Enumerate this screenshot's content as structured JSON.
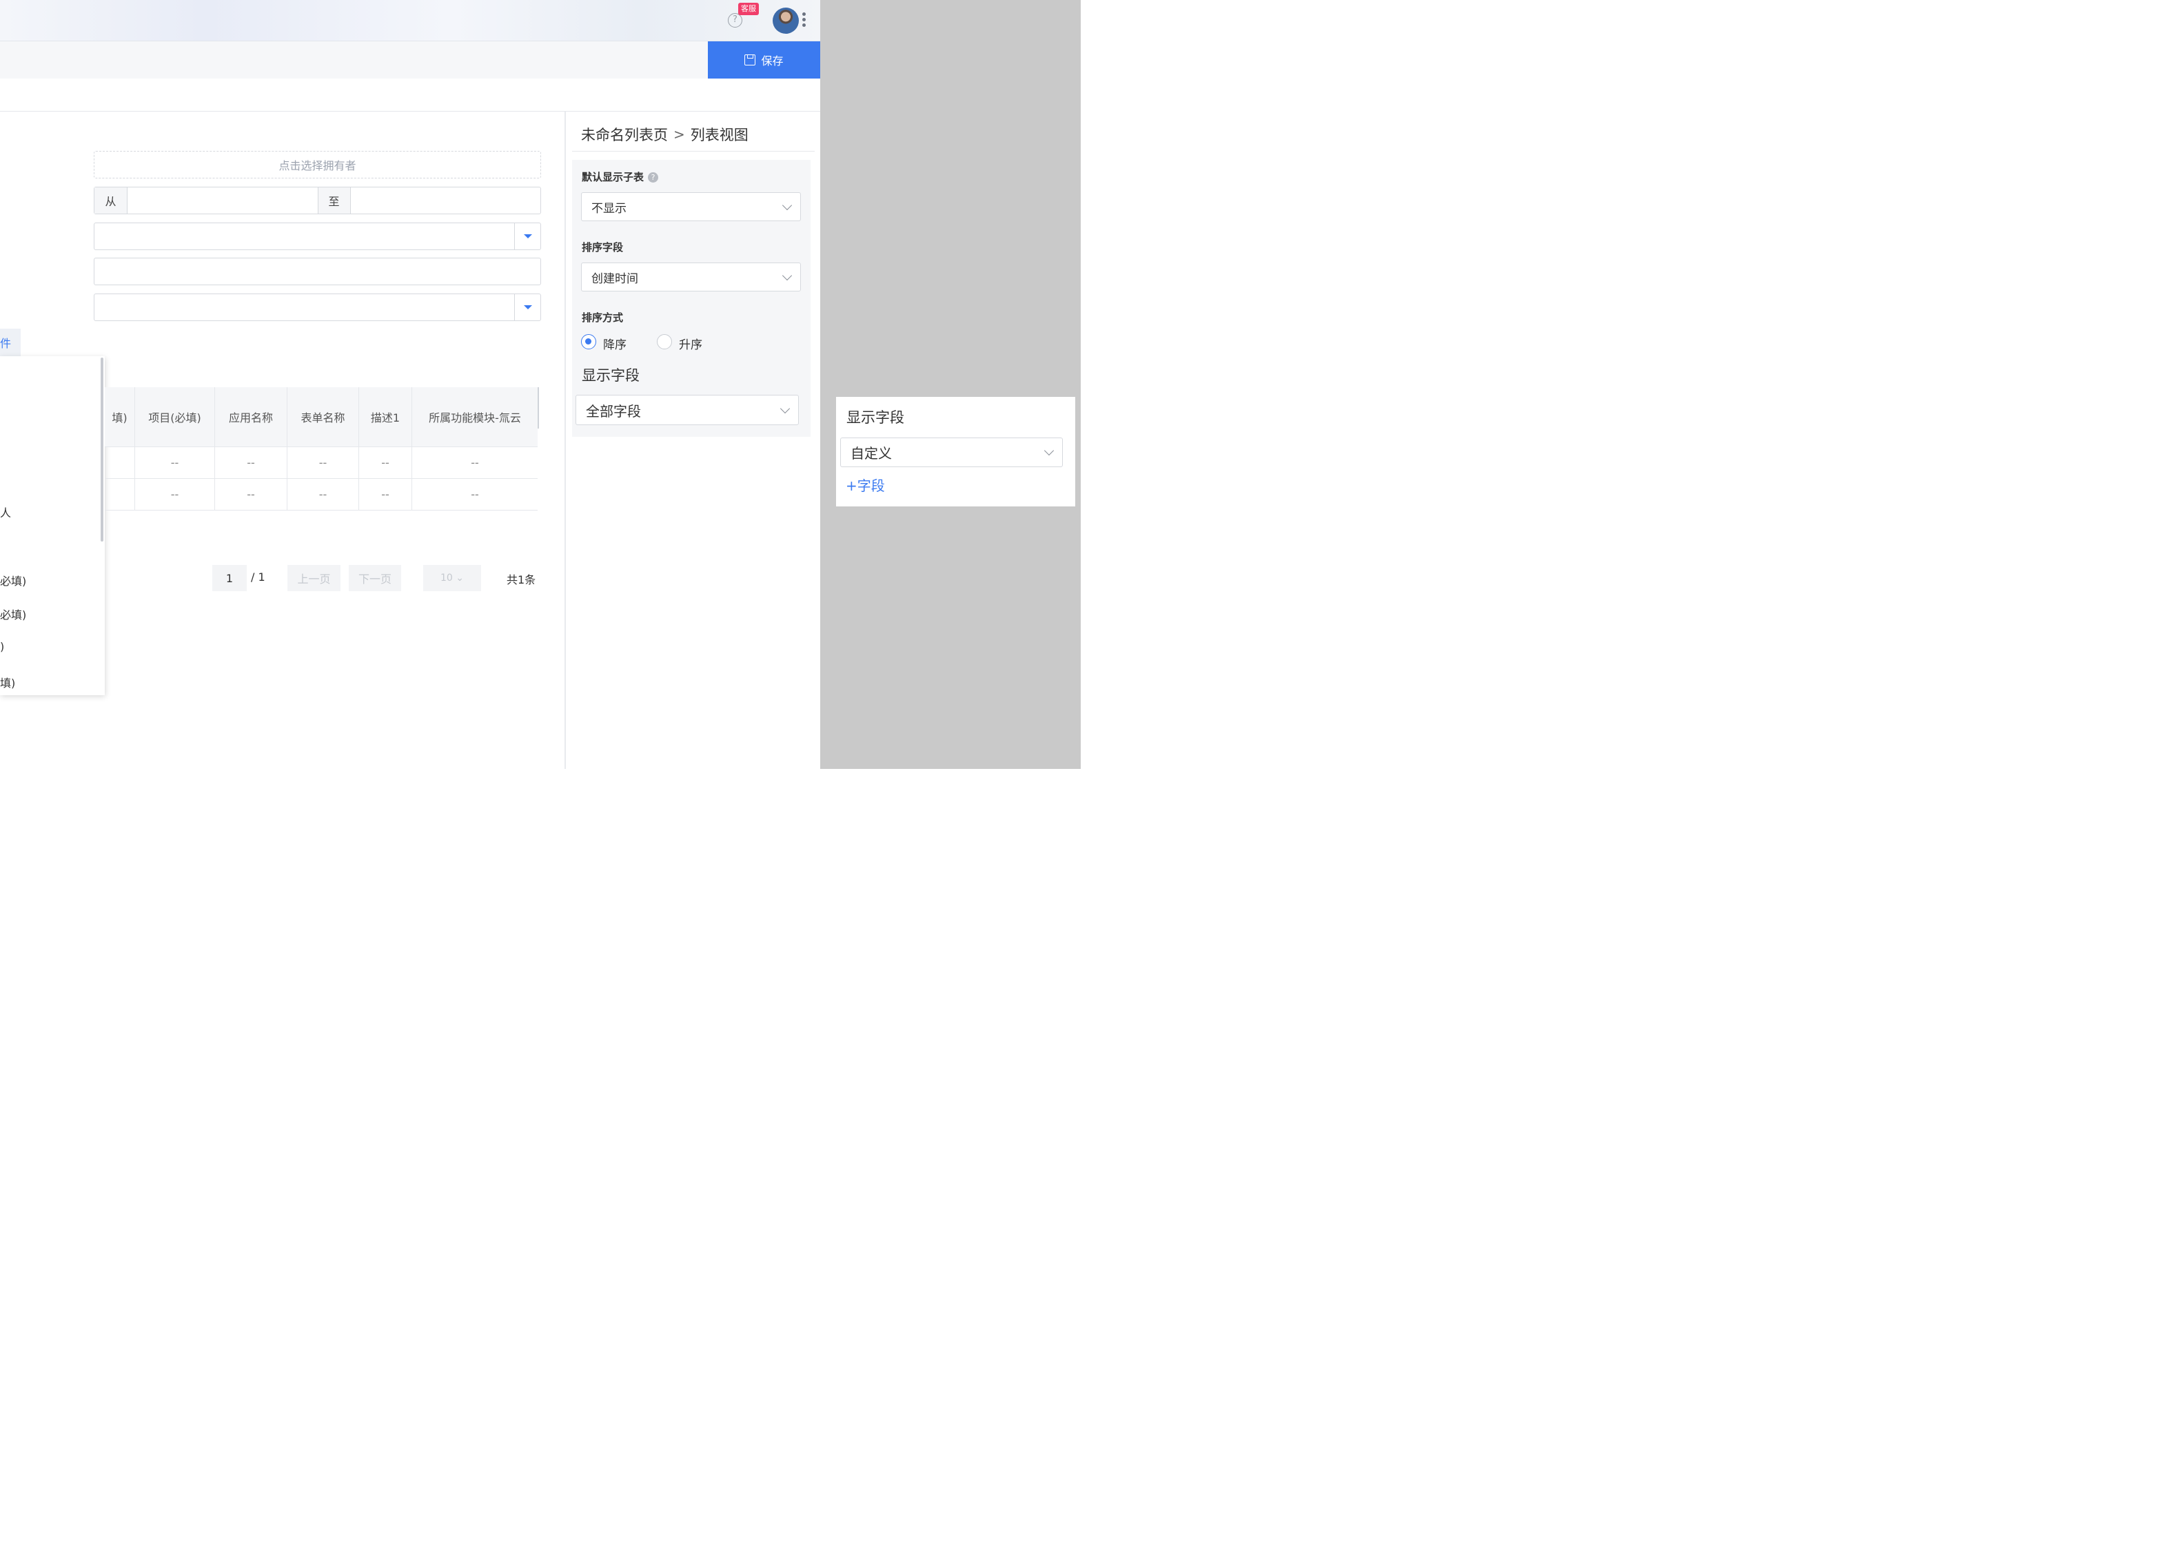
{
  "header": {
    "help_icon_glyph": "?",
    "kefu_badge": "客服",
    "save_label": "保存"
  },
  "filters": {
    "owner_placeholder": "点击选择拥有者",
    "range_from": "从",
    "range_to": "至"
  },
  "left_tag": "件",
  "dropdown_items": [
    "人",
    "必填)",
    "必填)",
    ")",
    "填)"
  ],
  "table": {
    "headers": [
      "填)",
      "项目(必填)",
      "应用名称",
      "表单名称",
      "描述1",
      "所属功能模块-氚云"
    ],
    "rows": [
      [
        "",
        "--",
        "--",
        "--",
        "--",
        "--"
      ],
      [
        "",
        "--",
        "--",
        "--",
        "--",
        "--"
      ]
    ]
  },
  "pagination": {
    "current": "1",
    "total": "/ 1",
    "prev": "上一页",
    "next": "下一页",
    "page_size": "10 ⌄",
    "count": "共1条"
  },
  "config": {
    "breadcrumb_page": "未命名列表页",
    "breadcrumb_sep": ">",
    "breadcrumb_view": "列表视图",
    "default_subtable_label": "默认显示子表",
    "default_subtable_value": "不显示",
    "sort_field_label": "排序字段",
    "sort_field_value": "创建时间",
    "sort_order_label": "排序方式",
    "sort_desc": "降序",
    "sort_asc": "升序",
    "sort_selected": "降序",
    "display_fields_title": "显示字段",
    "display_fields_value": "全部字段"
  },
  "popup": {
    "title": "显示字段",
    "value": "自定义",
    "add_field": "+字段"
  },
  "colors": {
    "accent": "#3b7af0",
    "badge": "#f03e6a",
    "overlay_gray": "#c9c9c9"
  }
}
